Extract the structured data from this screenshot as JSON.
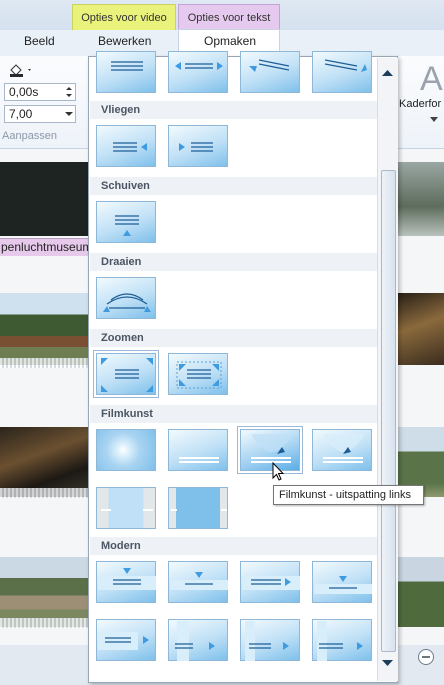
{
  "ribbon": {
    "context_tabs": [
      "Opties voor video",
      "Opties voor tekst"
    ],
    "tabs": [
      "Beeld",
      "Bewerken",
      "Opmaken"
    ],
    "start_time": "0,00s",
    "duration": "7,00",
    "group_label": "Aanpassen",
    "right_label": "Kaderfor",
    "big_letter": "A"
  },
  "storyboard": {
    "caption": "penluchtmuseum"
  },
  "gallery": {
    "sections": [
      {
        "title": "Vliegen"
      },
      {
        "title": "Schuiven"
      },
      {
        "title": "Draaien"
      },
      {
        "title": "Zoomen"
      },
      {
        "title": "Filmkunst"
      },
      {
        "title": "Modern"
      }
    ]
  },
  "tooltip": "Filmkunst - uitspatting links",
  "colors": {
    "accent": "#3f9be0",
    "tile": "#bfe0f6"
  }
}
